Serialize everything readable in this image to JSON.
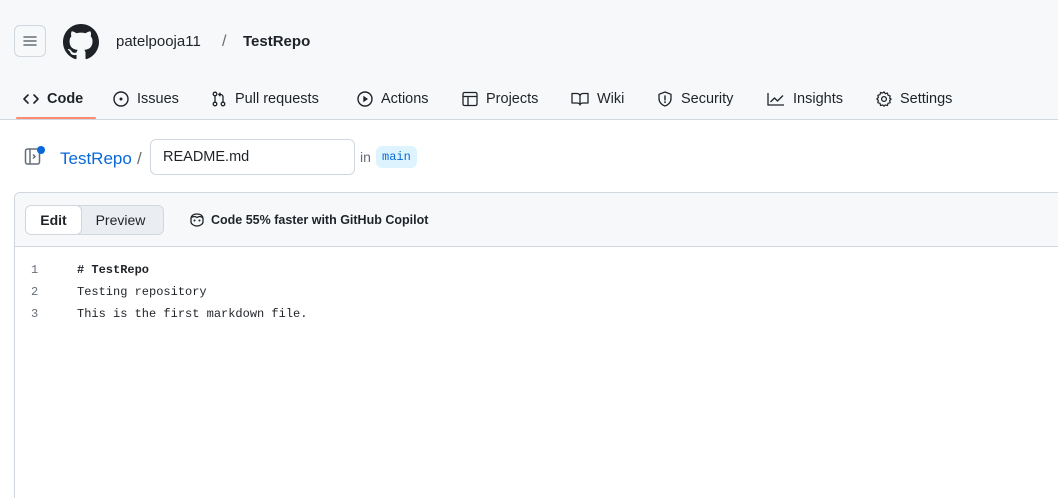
{
  "header": {
    "owner": "patelpooja11",
    "separator": "/",
    "repo": "TestRepo"
  },
  "tabs": [
    {
      "label": "Code",
      "icon": "code-icon",
      "selected": true
    },
    {
      "label": "Issues",
      "icon": "issue-icon",
      "selected": false
    },
    {
      "label": "Pull requests",
      "icon": "pull-request-icon",
      "selected": false
    },
    {
      "label": "Actions",
      "icon": "play-icon",
      "selected": false
    },
    {
      "label": "Projects",
      "icon": "table-icon",
      "selected": false
    },
    {
      "label": "Wiki",
      "icon": "book-icon",
      "selected": false
    },
    {
      "label": "Security",
      "icon": "shield-icon",
      "selected": false
    },
    {
      "label": "Insights",
      "icon": "graph-icon",
      "selected": false
    },
    {
      "label": "Settings",
      "icon": "gear-icon",
      "selected": false
    }
  ],
  "file_path": {
    "repo_link": "TestRepo",
    "slash": "/",
    "filename": "README.md",
    "in_label": "in",
    "branch": "main"
  },
  "editor": {
    "edit_label": "Edit",
    "preview_label": "Preview",
    "copilot_text": "Code 55% faster with GitHub Copilot",
    "lines": [
      {
        "number": "1",
        "text": "# TestRepo"
      },
      {
        "number": "2",
        "text": "Testing repository"
      },
      {
        "number": "3",
        "text": "This is the first markdown file."
      }
    ]
  },
  "colors": {
    "accent_link": "#0969da",
    "tab_underline": "#fd8c73",
    "header_bg": "#f6f8fa",
    "branch_badge_bg": "#ddf4ff"
  }
}
